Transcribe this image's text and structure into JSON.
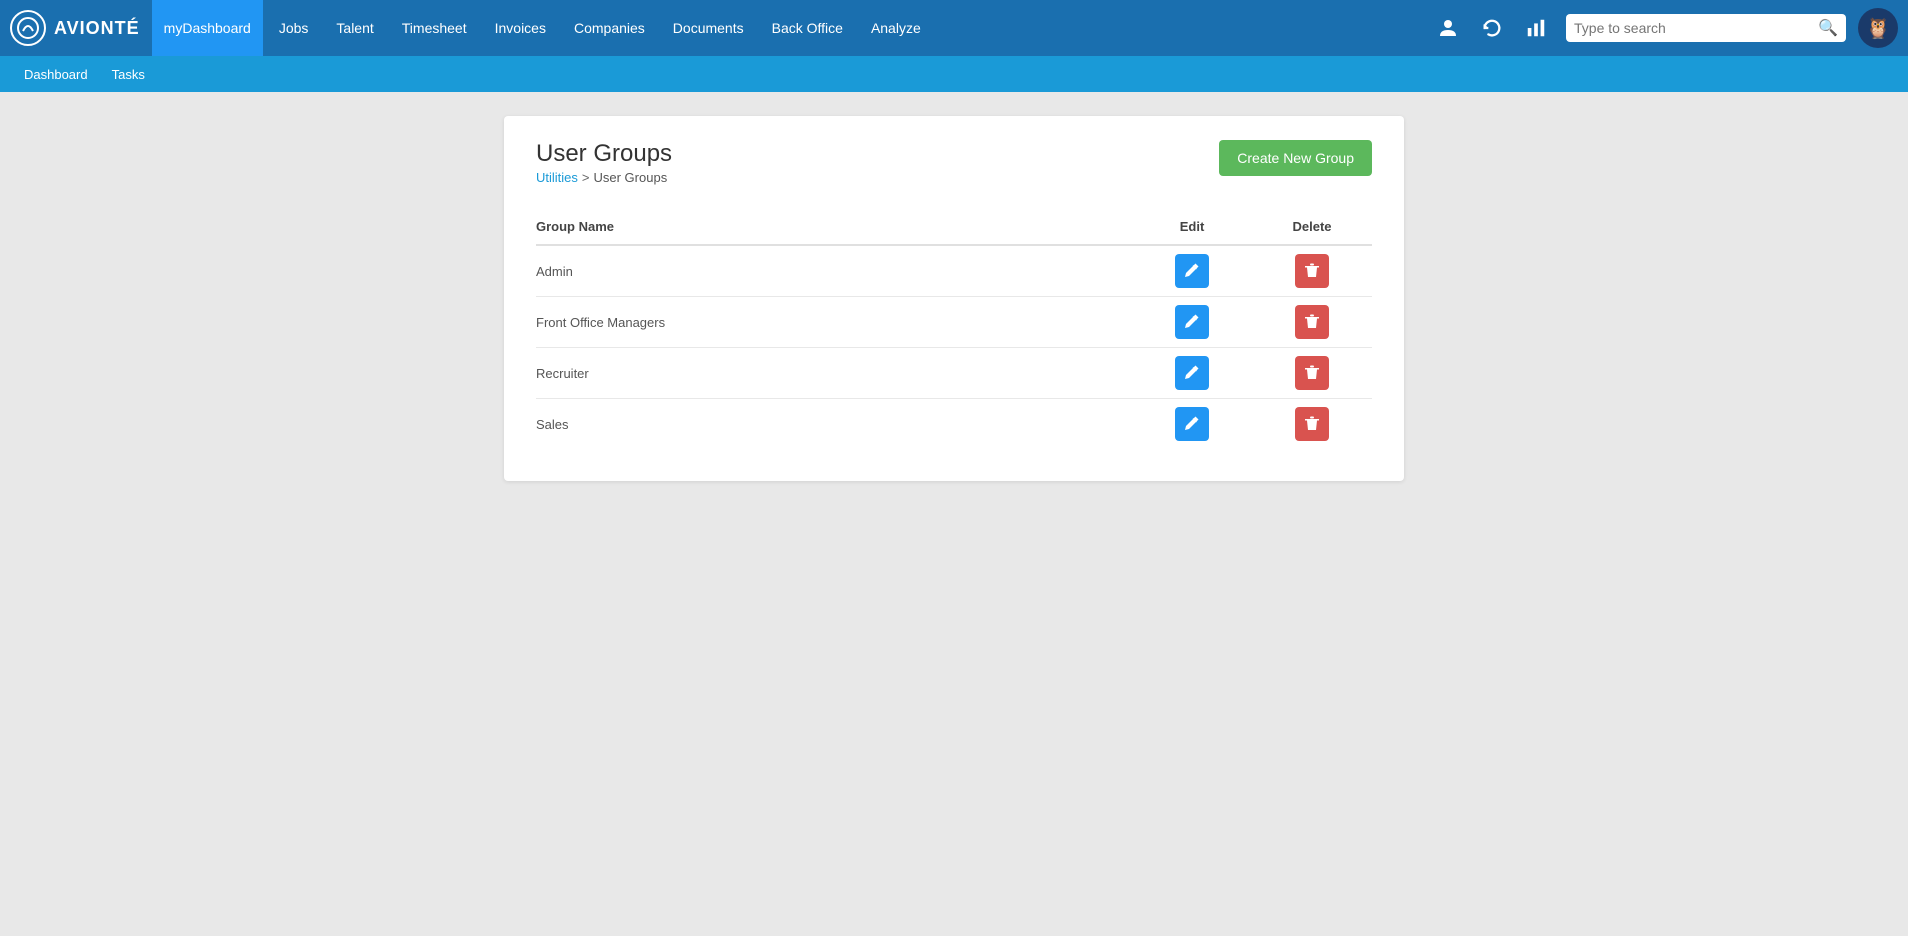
{
  "app": {
    "logo_text": "AVIONTÉ",
    "owl_emoji": "🦉"
  },
  "nav": {
    "active_item": "myDashboard",
    "items": [
      {
        "label": "myDashboard",
        "active": true
      },
      {
        "label": "Jobs",
        "active": false
      },
      {
        "label": "Talent",
        "active": false
      },
      {
        "label": "Timesheet",
        "active": false
      },
      {
        "label": "Invoices",
        "active": false
      },
      {
        "label": "Companies",
        "active": false
      },
      {
        "label": "Documents",
        "active": false
      },
      {
        "label": "Back Office",
        "active": false
      },
      {
        "label": "Analyze",
        "active": false
      }
    ],
    "search_placeholder": "Type to search"
  },
  "subnav": {
    "items": [
      {
        "label": "Dashboard"
      },
      {
        "label": "Tasks"
      }
    ]
  },
  "page": {
    "title": "User Groups",
    "breadcrumb": {
      "link_label": "Utilities",
      "separator": ">",
      "current": "User Groups"
    },
    "create_button": "Create New Group",
    "table": {
      "columns": [
        {
          "label": "Group Name"
        },
        {
          "label": "Edit"
        },
        {
          "label": "Delete"
        }
      ],
      "rows": [
        {
          "name": "Admin"
        },
        {
          "name": "Front Office Managers"
        },
        {
          "name": "Recruiter"
        },
        {
          "name": "Sales"
        }
      ]
    }
  }
}
